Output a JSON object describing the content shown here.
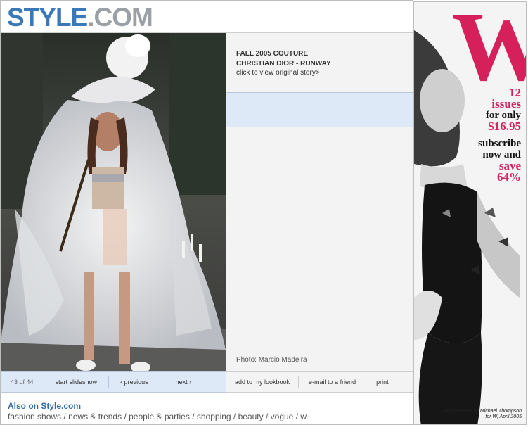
{
  "header": {
    "logo_part1": "STYLE",
    "logo_part2": ".COM"
  },
  "story": {
    "title_line1": "FALL 2005 COUTURE",
    "title_line2": "CHRISTIAN DIOR - RUNWAY",
    "link_text": "click to view original story>",
    "photo_credit": "Photo: Marcio Madeira"
  },
  "nav": {
    "counter": "43 of 44",
    "start_slideshow": "start slideshow",
    "previous": "‹ previous",
    "next": "next ›",
    "add_lookbook": "add to my lookbook",
    "email_friend": "e-mail to a friend",
    "print": "print"
  },
  "also_on": {
    "heading": "Also on Style.com",
    "links": [
      "fashion shows",
      "news & trends",
      "people & parties",
      "shopping",
      "beauty",
      "vogue",
      "w"
    ]
  },
  "ad": {
    "logo": "W",
    "line1": "12",
    "line2": "issues",
    "line3": "for only",
    "line4": "$16.95",
    "line5": "subscribe",
    "line6": "now and",
    "line7": "save",
    "line8": "64%",
    "credit_line1": "Photographed by Michael Thompson",
    "credit_line2": "for W, April 2005"
  },
  "colors": {
    "brand_blue": "#3a78b8",
    "brand_gray": "#9aa0a6",
    "ad_pink": "#d6205b",
    "panel_blue": "#dde9f7"
  }
}
